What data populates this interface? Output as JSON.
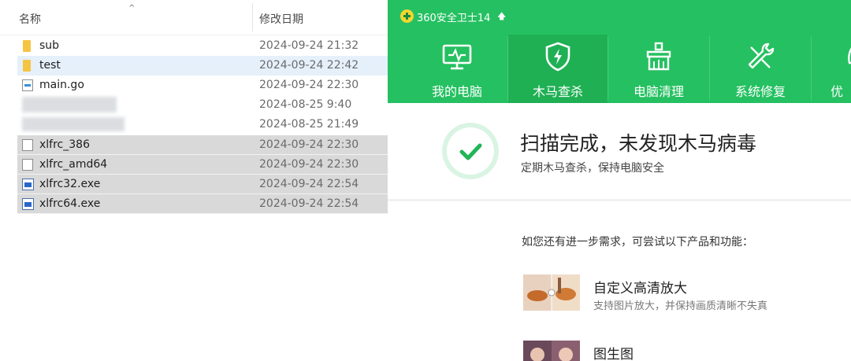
{
  "explorer": {
    "columns": {
      "name": "名称",
      "modified": "修改日期"
    },
    "sort_indicator": "^",
    "files": [
      {
        "name": "sub",
        "modified": "2024-09-24 21:32",
        "icon": "folder-icon"
      },
      {
        "name": "test",
        "modified": "2024-09-24 22:42",
        "icon": "folder-icon"
      },
      {
        "name": "main.go",
        "modified": "2024-09-24 22:30",
        "icon": "go-file-icon"
      },
      {
        "name": "",
        "modified": "2024-08-25 9:40",
        "icon": "file-icon"
      },
      {
        "name": "",
        "modified": "2024-08-25 21:49",
        "icon": "file-icon"
      },
      {
        "name": "xlfrc_386",
        "modified": "2024-09-24 22:30",
        "icon": "file-icon"
      },
      {
        "name": "xlfrc_amd64",
        "modified": "2024-09-24 22:30",
        "icon": "file-icon"
      },
      {
        "name": "xlfrc32.exe",
        "modified": "2024-09-24 22:54",
        "icon": "exe-icon"
      },
      {
        "name": "xlfrc64.exe",
        "modified": "2024-09-24 22:54",
        "icon": "exe-icon"
      }
    ]
  },
  "app360": {
    "title": "360安全卫士14",
    "title_arrow": "🡅",
    "tabs": [
      {
        "label": "我的电脑",
        "icon": "monitor-icon"
      },
      {
        "label": "木马查杀",
        "icon": "shield-lightning-icon"
      },
      {
        "label": "电脑清理",
        "icon": "broom-icon"
      },
      {
        "label": "系统修复",
        "icon": "wrench-icon"
      },
      {
        "label": "优",
        "icon": "rocket-icon"
      }
    ],
    "active_tab": "木马查杀",
    "result_title": "扫描完成，未发现木马病毒",
    "result_subtitle": "定期木马查杀，保持电脑安全",
    "more_text": "如您还有进一步需求，可尝试以下产品和功能：",
    "products": [
      {
        "title": "自定义高清放大",
        "desc": "支持图片放大，并保持画质清晰不失真"
      },
      {
        "title": "图生图",
        "desc": ""
      }
    ],
    "colors": {
      "brand_green": "#25c061",
      "active_tab": "#1fb054",
      "check_green": "#21b557",
      "ring_green": "#d9f4e3"
    }
  }
}
